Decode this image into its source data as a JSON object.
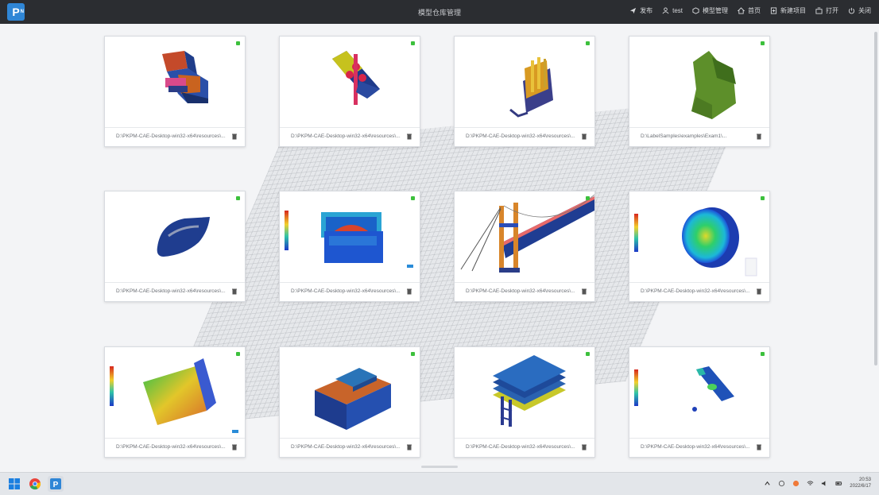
{
  "app": {
    "logo_text": "P",
    "logo_sub": "N"
  },
  "titlebar": {
    "title": "模型仓库管理",
    "actions": [
      {
        "icon": "send-icon",
        "label": "发布"
      },
      {
        "icon": "user-icon",
        "label": "test"
      },
      {
        "icon": "cube-icon",
        "label": "模型管理"
      },
      {
        "icon": "home-icon",
        "label": "首页"
      },
      {
        "icon": "new-file-icon",
        "label": "新建项目"
      },
      {
        "icon": "open-icon",
        "label": "打开"
      },
      {
        "icon": "power-icon",
        "label": "关闭"
      }
    ]
  },
  "cards": [
    {
      "path": "D:\\PKPM-CAE-Desktop-win32-x64\\resources\\...",
      "model": "joint-block"
    },
    {
      "path": "D:\\PKPM-CAE-Desktop-win32-x64\\resources\\...",
      "model": "bolted-beam"
    },
    {
      "path": "D:\\PKPM-CAE-Desktop-win32-x64\\resources\\...",
      "model": "building-assembly"
    },
    {
      "path": "D:\\LabelSamples\\examples\\Exam1\\...",
      "model": "green-mesh"
    },
    {
      "path": "D:\\PKPM-CAE-Desktop-win32-x64\\resources\\...",
      "model": "blue-shell"
    },
    {
      "path": "D:\\PKPM-CAE-Desktop-win32-x64\\resources\\...",
      "model": "contour-box"
    },
    {
      "path": "D:\\PKPM-CAE-Desktop-win32-x64\\resources\\...",
      "model": "bridge"
    },
    {
      "path": "D:\\PKPM-CAE-Desktop-win32-x64\\resources\\...",
      "model": "disc-contour"
    },
    {
      "path": "D:\\PKPM-CAE-Desktop-win32-x64\\resources\\...",
      "model": "plate-contour"
    },
    {
      "path": "D:\\PKPM-CAE-Desktop-win32-x64\\resources\\...",
      "model": "l-slab"
    },
    {
      "path": "D:\\PKPM-CAE-Desktop-win32-x64\\resources\\...",
      "model": "stacked-plates"
    },
    {
      "path": "D:\\PKPM-CAE-Desktop-win32-x64\\resources\\...",
      "model": "small-bracket"
    }
  ],
  "taskbar": {
    "apps": [
      "windows-start-icon",
      "chrome-icon",
      "pkpm-app-icon"
    ],
    "tray": [
      "chevron-up-icon",
      "ime-icon",
      "app-tray-icon",
      "wifi-icon",
      "volume-icon",
      "battery-icon"
    ],
    "time": "20:53",
    "date": "2022/6/17"
  },
  "colors": {
    "titlebar": "#2b2d31",
    "status_ok": "#3cc03c",
    "accent": "#2f86d6"
  }
}
